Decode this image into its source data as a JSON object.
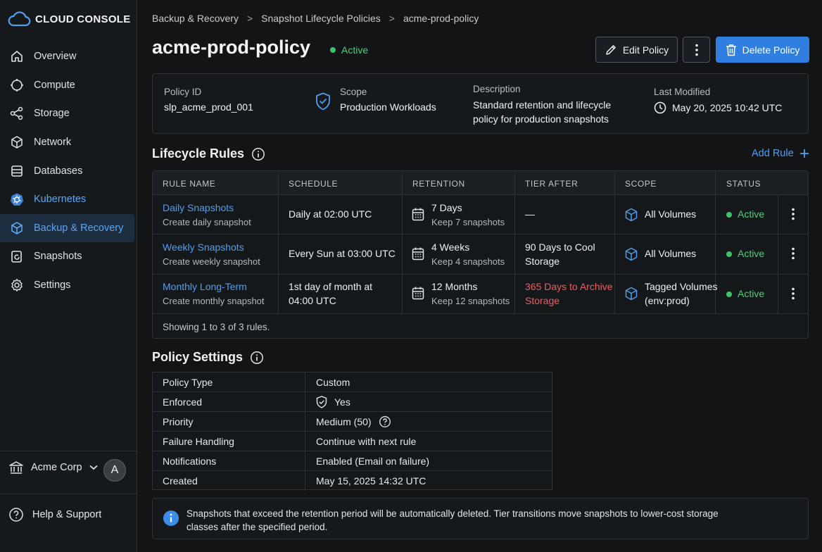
{
  "app": {
    "brand": "CLOUD CONSOLE"
  },
  "sidebar": {
    "items": [
      {
        "label": "Overview",
        "icon": "home-icon"
      },
      {
        "label": "Compute",
        "icon": "cpu-icon"
      },
      {
        "label": "Storage",
        "icon": "share-nodes-icon"
      },
      {
        "label": "Network",
        "icon": "network-icon"
      },
      {
        "label": "Databases",
        "icon": "database-icon"
      },
      {
        "label": "Kubernetes",
        "icon": "kubernetes-icon"
      },
      {
        "label": "Backup & Recovery",
        "icon": "cube-icon"
      },
      {
        "label": "Snapshots",
        "icon": "snapshot-icon"
      },
      {
        "label": "Settings",
        "icon": "gear-icon"
      }
    ],
    "active": "Backup & Recovery",
    "org": {
      "name": "Acme Corp",
      "avatar": "A"
    },
    "help": "Help & Support"
  },
  "breadcrumb": [
    "Backup & Recovery",
    "Snapshot Lifecycle Policies",
    "acme-prod-policy"
  ],
  "header": {
    "title": "acme-prod-policy",
    "status": "Active",
    "edit_label": "Edit Policy",
    "delete_label": "Delete Policy"
  },
  "meta": {
    "policy_id_label": "Policy ID",
    "policy_id": "slp_acme_prod_001",
    "scope_label": "Scope",
    "scope": "Production Workloads",
    "description_label": "Description",
    "description_line1": "Standard retention and lifecycle",
    "description_line2": "policy for production snapshots",
    "modified_label": "Last Modified",
    "modified": "May 20, 2025 10:42 UTC"
  },
  "rules": {
    "title": "Lifecycle Rules",
    "add_label": "Add Rule",
    "columns": [
      "RULE NAME",
      "SCHEDULE",
      "RETENTION",
      "TIER AFTER",
      "SCOPE",
      "STATUS"
    ],
    "rows": [
      {
        "name": "Daily Snapshots",
        "desc": "Create daily snapshot",
        "schedule1": "Daily at 02:00 UTC",
        "schedule2": "",
        "retention": "7 Days",
        "retention_sub": "Keep 7 snapshots",
        "tier1": "—",
        "tier2": "",
        "scope1": "All Volumes",
        "scope2": "",
        "status": "Active"
      },
      {
        "name": "Weekly Snapshots",
        "desc": "Create weekly snapshot",
        "schedule1": "Every Sun at 03:00 UTC",
        "schedule2": "",
        "retention": "4 Weeks",
        "retention_sub": "Keep 4 snapshots",
        "tier1": "90 Days to Cool",
        "tier2": "Storage",
        "scope1": "All Volumes",
        "scope2": "",
        "status": "Active"
      },
      {
        "name": "Monthly Long-Term",
        "desc": "Create monthly snapshot",
        "schedule1": "1st day of month at",
        "schedule2": "04:00 UTC",
        "retention": "12 Months",
        "retention_sub": "Keep 12 snapshots",
        "tier1": "365 Days to Archive",
        "tier2": "Storage",
        "scope1": "Tagged Volumes",
        "scope2": "(env:prod)",
        "status": "Active"
      }
    ],
    "footer": "Showing 1 to 3 of 3 rules."
  },
  "settings": {
    "title": "Policy Settings",
    "rows": [
      {
        "key": "Policy Type",
        "value": "Custom"
      },
      {
        "key": "Enforced",
        "value": "Yes"
      },
      {
        "key": "Priority",
        "value": "Medium (50)"
      },
      {
        "key": "Failure Handling",
        "value": "Continue with next rule"
      },
      {
        "key": "Notifications",
        "value": "Enabled (Email on failure)"
      },
      {
        "key": "Created",
        "value": "May 15, 2025 14:32 UTC"
      }
    ]
  },
  "info": {
    "line1": "Snapshots that exceed the retention period will be automatically deleted. Tier transitions move snapshots to lower-cost storage",
    "line2": "classes after the specified period."
  },
  "colors": {
    "accent": "#2f7fe0",
    "link": "#4e9ff0",
    "success": "#3cc46a",
    "danger": "#ef5b5b"
  }
}
